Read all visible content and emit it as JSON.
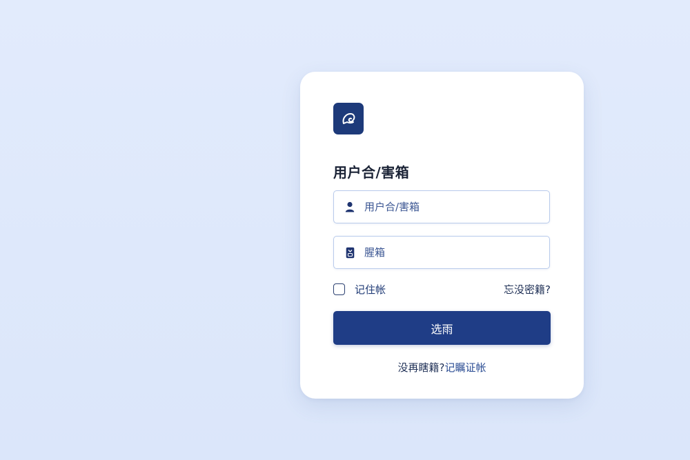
{
  "colors": {
    "background": "#dde8fb",
    "card": "#ffffff",
    "brand": "#1f3d86",
    "logo": "#1d3a7a",
    "field_border": "#b8caeb"
  },
  "logo": {
    "icon": "app-logo-icon"
  },
  "form": {
    "title": "用户合/害箱",
    "username": {
      "placeholder": "用户合/害箱",
      "value": "",
      "icon": "user-icon"
    },
    "password": {
      "placeholder": "腥箱",
      "value": "",
      "icon": "lock-icon"
    },
    "remember_label": "记住帐",
    "forgot_label": "忘没密籍?",
    "submit_label": "选雨"
  },
  "footer": {
    "prompt": "没再瞎籍?",
    "signup_label": "记瞩证帐"
  }
}
